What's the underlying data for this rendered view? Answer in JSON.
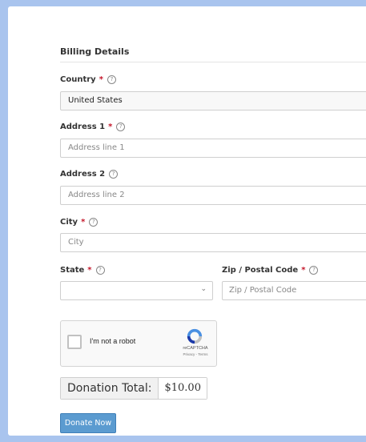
{
  "billing": {
    "title": "Billing Details",
    "required_marker": "*",
    "help_glyph": "?"
  },
  "fields": {
    "country": {
      "label": "Country",
      "value": "United States"
    },
    "address1": {
      "label": "Address 1",
      "placeholder": "Address line 1"
    },
    "address2": {
      "label": "Address 2",
      "placeholder": "Address line 2"
    },
    "city": {
      "label": "City",
      "placeholder": "City"
    },
    "state": {
      "label": "State",
      "value": ""
    },
    "zip": {
      "label": "Zip / Postal Code",
      "placeholder": "Zip / Postal Code"
    }
  },
  "recaptcha": {
    "checkbox_label": "I'm not a robot",
    "brand": "reCAPTCHA",
    "links": "Privacy - Terms"
  },
  "donation": {
    "total_label": "Donation Total:",
    "total_amount": "$10.00"
  },
  "submit": {
    "label": "Donate Now"
  },
  "colors": {
    "accent": "#5b9bd0",
    "required": "#c4162a",
    "page_bg": "#a9c4ee"
  }
}
